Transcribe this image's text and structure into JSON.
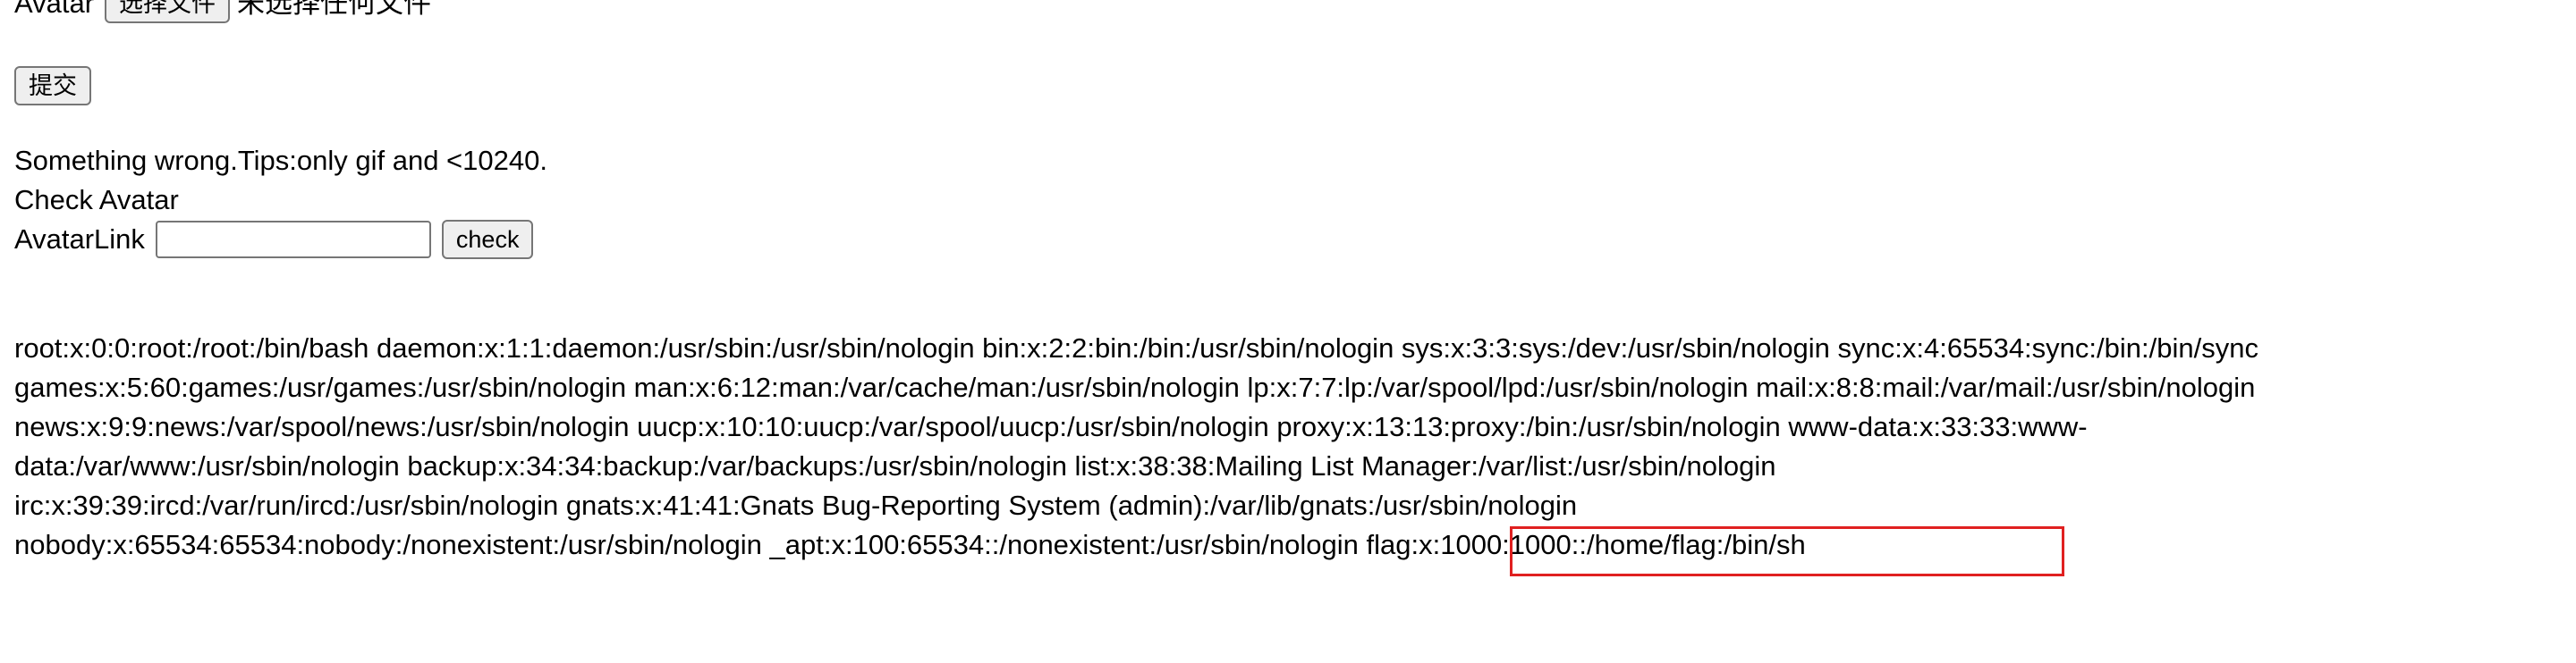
{
  "upload": {
    "avatar_label": "Avatar",
    "choose_file_label": "选择文件",
    "no_file_text": "未选择任何文件",
    "submit_label": "提交"
  },
  "message": {
    "error_text": "Something wrong.Tips:only gif and <10240.",
    "check_heading": "Check Avatar"
  },
  "check_form": {
    "link_label": "AvatarLink",
    "link_value": "",
    "check_label": "check"
  },
  "output": {
    "line1": "root:x:0:0:root:/root:/bin/bash daemon:x:1:1:daemon:/usr/sbin:/usr/sbin/nologin bin:x:2:2:bin:/bin:/usr/sbin/nologin sys:x:3:3:sys:/dev:/usr/sbin/nologin sync:x:4:65534:sync:/bin:/bin/sync",
    "line2": "games:x:5:60:games:/usr/games:/usr/sbin/nologin man:x:6:12:man:/var/cache/man:/usr/sbin/nologin lp:x:7:7:lp:/var/spool/lpd:/usr/sbin/nologin mail:x:8:8:mail:/var/mail:/usr/sbin/nologin",
    "line3": "news:x:9:9:news:/var/spool/news:/usr/sbin/nologin uucp:x:10:10:uucp:/var/spool/uucp:/usr/sbin/nologin proxy:x:13:13:proxy:/bin:/usr/sbin/nologin www-data:x:33:33:www-",
    "line4": "data:/var/www:/usr/sbin/nologin backup:x:34:34:backup:/var/backups:/usr/sbin/nologin list:x:38:38:Mailing List Manager:/var/list:/usr/sbin/nologin",
    "line5": "irc:x:39:39:ircd:/var/run/ircd:/usr/sbin/nologin gnats:x:41:41:Gnats Bug-Reporting System (admin):/var/lib/gnats:/usr/sbin/nologin",
    "line6_prefix": "nobody:x:65534:65534:nobody:/nonexistent:/usr/sbin/nologin _apt:x:100:65534::/nonexistent:/usr/sbin/nologin",
    "line6_flag": "flag:x:1000:1000::/home/flag:/bin/sh"
  },
  "colors": {
    "highlight": "#e02020"
  }
}
